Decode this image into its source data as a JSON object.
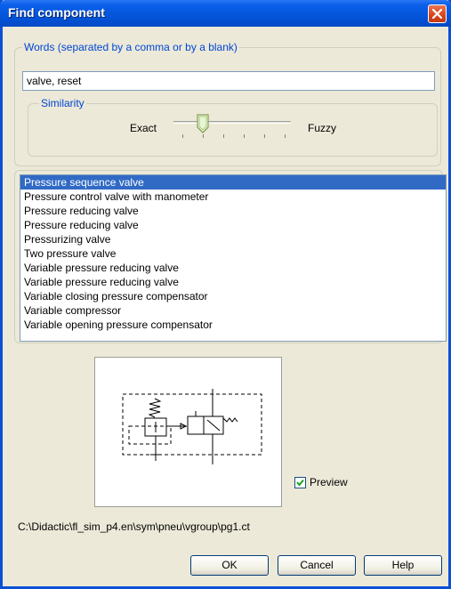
{
  "window": {
    "title": "Find component"
  },
  "words": {
    "legend": "Words (separated by a comma or by a blank)",
    "value": "valve, reset"
  },
  "similarity": {
    "legend": "Similarity",
    "left_label": "Exact",
    "right_label": "Fuzzy",
    "level": 0.2
  },
  "results": {
    "items": [
      "Pressure sequence valve",
      "Pressure control valve with manometer",
      "Pressure reducing valve",
      "Pressure reducing valve",
      "Pressurizing valve",
      "Two pressure valve",
      "Variable pressure reducing valve",
      "Variable pressure reducing valve",
      "Variable closing pressure compensator",
      "Variable compressor",
      "Variable opening pressure compensator"
    ],
    "selected_index": 0
  },
  "preview": {
    "label": "Preview",
    "checked": true
  },
  "path": "C:\\Didactic\\fl_sim_p4.en\\sym\\pneu\\vgroup\\pg1.ct",
  "buttons": {
    "ok": "OK",
    "cancel": "Cancel",
    "help": "Help"
  },
  "colors": {
    "title_bar": "#0352d6",
    "selection": "#316ac5",
    "legend_text": "#0046d5"
  }
}
